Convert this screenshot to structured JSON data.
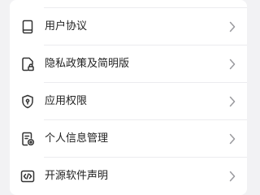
{
  "settings_list": {
    "items": [
      {
        "label": "用户协议",
        "icon": "book-icon"
      },
      {
        "label": "隐私政策及简明版",
        "icon": "document-lock-icon"
      },
      {
        "label": "应用权限",
        "icon": "shield-icon"
      },
      {
        "label": "个人信息管理",
        "icon": "document-settings-icon"
      },
      {
        "label": "开源软件声明",
        "icon": "code-icon"
      }
    ]
  }
}
